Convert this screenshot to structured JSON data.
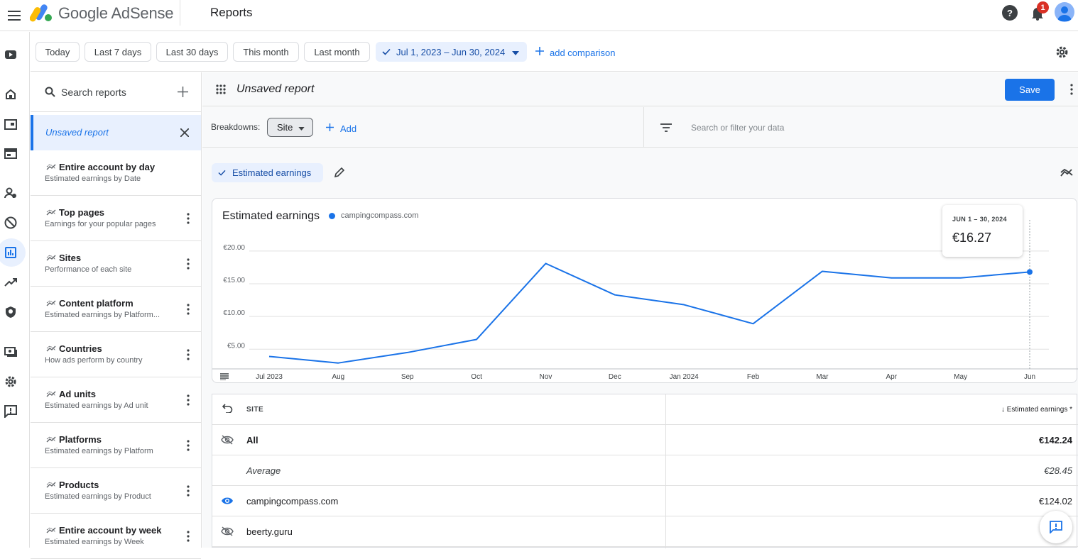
{
  "app": {
    "brand": "Google AdSense",
    "page_title": "Reports",
    "notification_count": "1"
  },
  "datebar": {
    "presets": [
      "Today",
      "Last 7 days",
      "Last 30 days",
      "This month",
      "Last month"
    ],
    "selected_range": "Jul 1, 2023 – Jun 30, 2024",
    "add_comparison": "add comparison"
  },
  "reports_sidebar": {
    "search_placeholder": "Search reports",
    "active_report": "Unsaved report",
    "items": [
      {
        "title": "Entire account by day",
        "subtitle": "Estimated earnings by Date"
      },
      {
        "title": "Top pages",
        "subtitle": "Earnings for your popular pages"
      },
      {
        "title": "Sites",
        "subtitle": "Performance of each site"
      },
      {
        "title": "Content platform",
        "subtitle": "Estimated earnings by Platform..."
      },
      {
        "title": "Countries",
        "subtitle": "How ads perform by country"
      },
      {
        "title": "Ad units",
        "subtitle": "Estimated earnings by Ad unit"
      },
      {
        "title": "Platforms",
        "subtitle": "Estimated earnings by Platform"
      },
      {
        "title": "Products",
        "subtitle": "Estimated earnings by Product"
      },
      {
        "title": "Entire account by week",
        "subtitle": "Estimated earnings by Week"
      }
    ]
  },
  "report": {
    "title": "Unsaved report",
    "save_label": "Save",
    "breakdowns_label": "Breakdowns:",
    "breakdown_value": "Site",
    "add_label": "Add",
    "filter_placeholder": "Search or filter your data",
    "metric_chip": "Estimated earnings"
  },
  "chart_data": {
    "type": "line",
    "title": "Estimated earnings",
    "legend": [
      {
        "name": "campingcompass.com",
        "color": "#1a73e8"
      }
    ],
    "categories": [
      "Jul 2023",
      "Aug",
      "Sep",
      "Oct",
      "Nov",
      "Dec",
      "Jan 2024",
      "Feb",
      "Mar",
      "Apr",
      "May",
      "Jun"
    ],
    "series": [
      {
        "name": "campingcompass.com",
        "values": [
          3.9,
          2.9,
          4.5,
          6.5,
          18.1,
          13.3,
          11.8,
          8.9,
          16.9,
          15.9,
          15.9,
          16.8
        ]
      }
    ],
    "y_ticks": [
      "€5.00",
      "€10.00",
      "€15.00",
      "€20.00"
    ],
    "ylim": [
      2,
      21.5
    ],
    "grid": true,
    "legend_position": "top-left",
    "tooltip": {
      "label": "JUN 1 – 30, 2024",
      "value": "€16.27"
    }
  },
  "table": {
    "col_site": "SITE",
    "col_earnings": "↓ Estimated earnings *",
    "rows": [
      {
        "site": "All",
        "value": "€142.24",
        "style": "bold"
      },
      {
        "site": "Average",
        "value": "€28.45",
        "style": "italic"
      },
      {
        "site": "campingcompass.com",
        "value": "€124.02",
        "style": "normal"
      },
      {
        "site": "beerty.guru",
        "value": "",
        "style": "normal"
      }
    ]
  }
}
